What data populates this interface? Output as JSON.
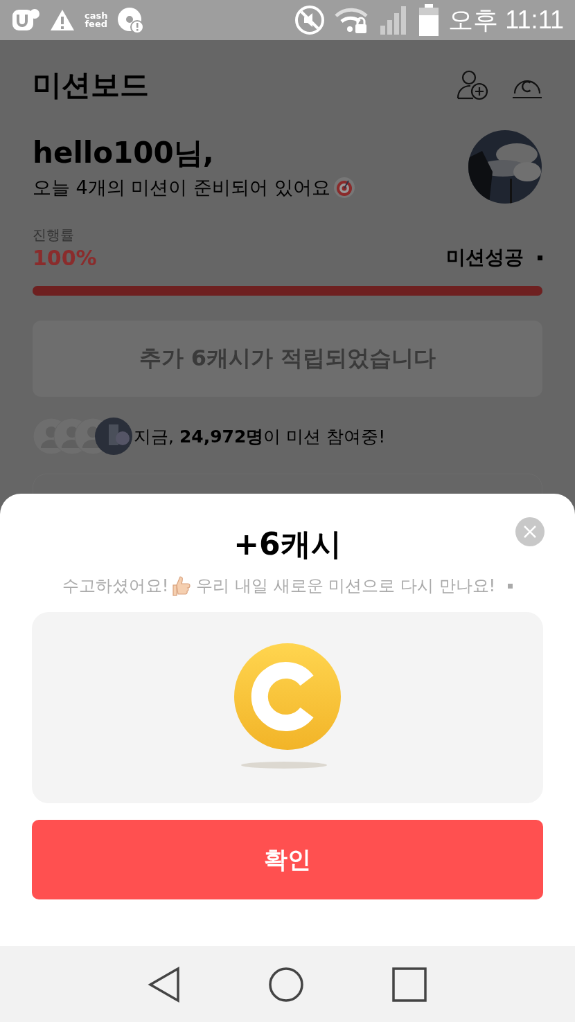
{
  "status_bar": {
    "logo_lines": [
      "cash",
      "feed"
    ],
    "time": "오후 11:11"
  },
  "header": {
    "title": "미션보드"
  },
  "greeting": {
    "name": "hello100님,",
    "message": "오늘 4개의 미션이 준비되어 있어요"
  },
  "progress": {
    "label": "진행률",
    "percent": "100%",
    "status": "미션성공",
    "level": 1.0
  },
  "bonus_button": {
    "label": "추가 6캐시가 적립되었습니다",
    "disabled": true
  },
  "participants": {
    "text": "지금, **24,972명**이 미션 참여중!"
  },
  "reward_sheet": {
    "title": "+6캐시",
    "message": "수고하셨어요!",
    "message_after": "우리 내일 새로운 미션으로 다시 만나요!",
    "confirm": "확인"
  }
}
